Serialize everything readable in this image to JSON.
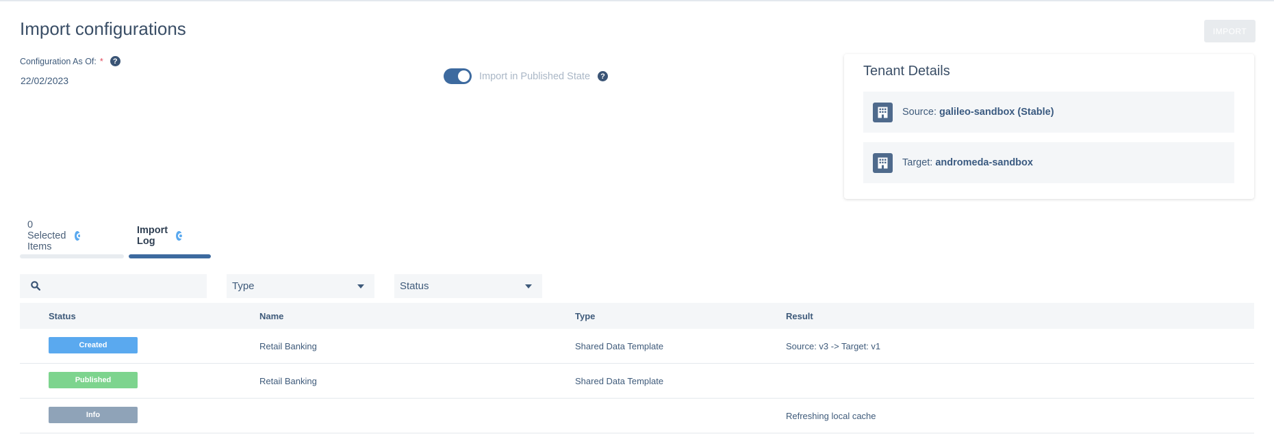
{
  "page": {
    "title": "Import configurations",
    "import_button": "IMPORT"
  },
  "config": {
    "label": "Configuration As Of:",
    "required_mark": "*",
    "date": "22/02/2023"
  },
  "toggle": {
    "label": "Import in Published State",
    "on": true
  },
  "tenant": {
    "title": "Tenant Details",
    "source_label": "Source:",
    "source_value": "galileo-sandbox (Stable)",
    "target_label": "Target:",
    "target_value": "andromeda-sandbox"
  },
  "tabs": [
    {
      "label": "0 Selected Items",
      "active": false
    },
    {
      "label": "Import Log",
      "active": true
    }
  ],
  "filters": {
    "search_placeholder": "",
    "type": "Type",
    "status": "Status"
  },
  "table": {
    "headers": [
      "Status",
      "Name",
      "Type",
      "Result"
    ],
    "rows": [
      {
        "status": "Created",
        "name": "Retail Banking",
        "type": "Shared Data Template",
        "result": "Source: v3 -> Target: v1"
      },
      {
        "status": "Published",
        "name": "Retail Banking",
        "type": "Shared Data Template",
        "result": ""
      },
      {
        "status": "Info",
        "name": "",
        "type": "",
        "result": "Refreshing local cache"
      }
    ]
  },
  "colors": {
    "accent": "#3d6a9f",
    "created": "#5aa9ef",
    "published": "#7dd48e",
    "info": "#8fa3b8",
    "tab_active": "#3d6a9f",
    "tab_inactive": "#e8ecf0"
  },
  "icons": {
    "help": "question-circle-icon",
    "building": "building-icon",
    "search": "search-icon",
    "tab_indicator": "radio-circle-icon",
    "dropdown": "chevron-down-icon"
  }
}
